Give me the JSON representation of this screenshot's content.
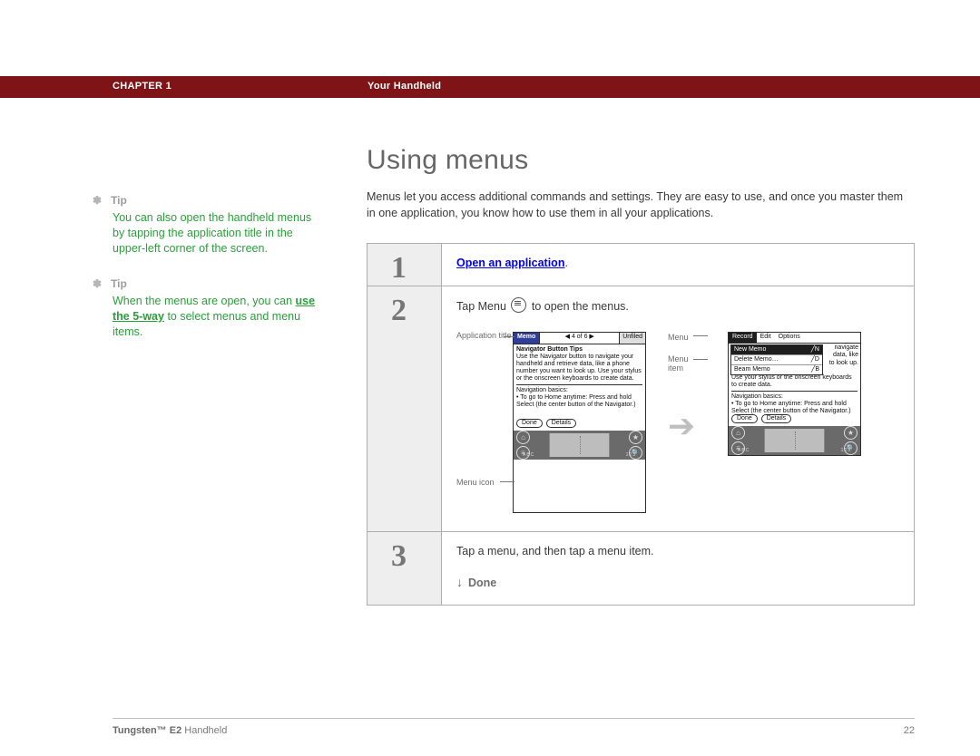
{
  "header": {
    "chapter": "CHAPTER 1",
    "section": "Your Handheld"
  },
  "sidebar": {
    "tips": [
      {
        "label": "Tip",
        "body": "You can also open the handheld menus by tapping the application title in the upper-left corner of the screen."
      },
      {
        "label": "Tip",
        "body_pre": "When the menus are open, you can ",
        "link": "use the 5-way",
        "body_post": " to select menus and menu items."
      }
    ]
  },
  "main": {
    "title": "Using menus",
    "intro": "Menus let you access additional commands and settings. They are easy to use, and once you master them in one application, you know how to use them in all your applications.",
    "steps": [
      {
        "num": "1",
        "action_link": "Open an application",
        "suffix": "."
      },
      {
        "num": "2",
        "text_pre": "Tap Menu ",
        "text_post": " to open the menus."
      },
      {
        "num": "3",
        "text": "Tap a menu, and then tap a menu item.",
        "done": "Done"
      }
    ],
    "callouts_left": {
      "app_title": "Application title",
      "menu_icon": "Menu icon"
    },
    "callouts_right": {
      "menu": "Menu",
      "menu_item": "Menu item"
    },
    "palm": {
      "memo_tab": "Memo",
      "page_indicator": "◀  4 of 6  ▶",
      "category": "Unfiled",
      "body_title": "Navigator Button Tips",
      "body": "Use the Navigator button to navigate your handheld and retrieve data, like a phone number you want to look up. Use your stylus or the onscreen keyboards to create data.",
      "nav_title": "Navigation basics:",
      "nav_body": "• To go to Home anytime: Press and hold Select (the center button of the Navigator.)",
      "btn_done": "Done",
      "btn_details": "Details",
      "abc": "ABC",
      "n123": "123",
      "menu_bar": [
        "Record",
        "Edit",
        "Options"
      ],
      "dropdown": [
        {
          "label": "New Memo",
          "accel": "╱N"
        },
        {
          "label": "Delete Memo…",
          "accel": "╱D"
        },
        {
          "label": "Beam Memo",
          "accel": "╱B"
        }
      ],
      "frag1": "navigate",
      "frag2": "data, like",
      "frag3": "to look up."
    }
  },
  "footer": {
    "product_bold": "Tungsten™ E2",
    "product_rest": " Handheld",
    "page": "22"
  }
}
